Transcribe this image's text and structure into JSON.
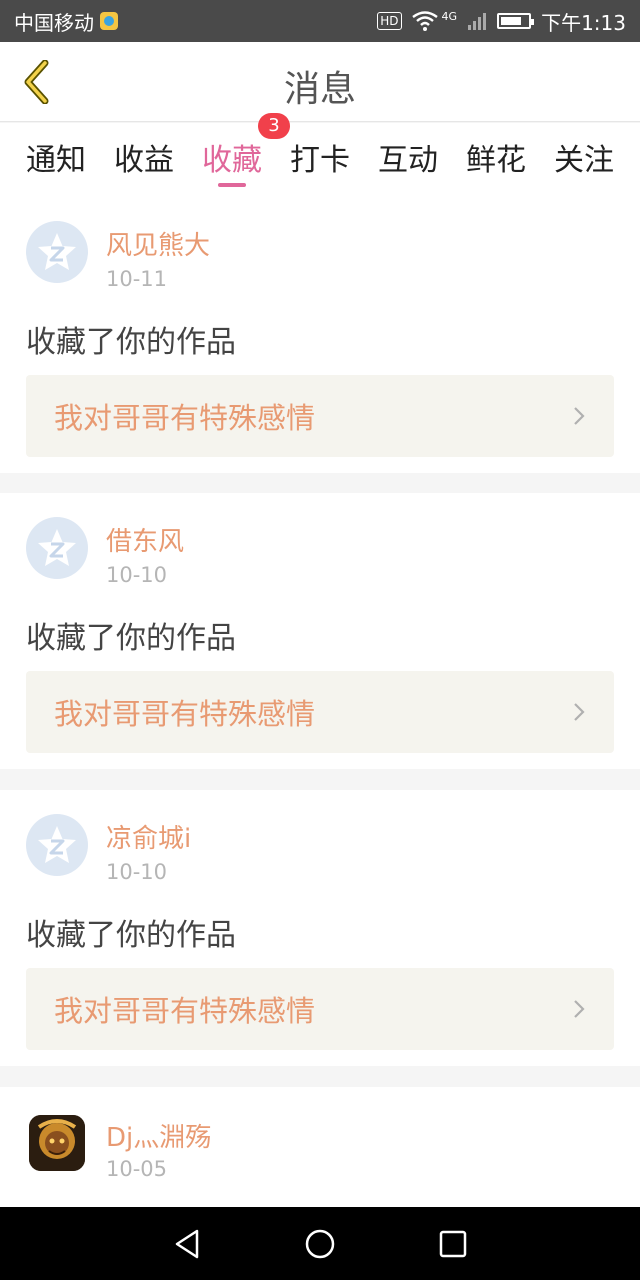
{
  "status_bar": {
    "carrier": "中国移动",
    "hd": "HD",
    "network": "4G",
    "time": "下午1:13"
  },
  "header": {
    "title": "消息",
    "back_icon": "back-chevron-icon"
  },
  "tabs": [
    {
      "label": "通知"
    },
    {
      "label": "收益"
    },
    {
      "label": "收藏",
      "active": true,
      "badge": "3"
    },
    {
      "label": "打卡"
    },
    {
      "label": "互动"
    },
    {
      "label": "鲜花"
    },
    {
      "label": "关注"
    }
  ],
  "messages": [
    {
      "user": "风见熊大",
      "date": "10-11",
      "action": "收藏了你的作品",
      "work_title": "我对哥哥有特殊感情"
    },
    {
      "user": "借东风",
      "date": "10-10",
      "action": "收藏了你的作品",
      "work_title": "我对哥哥有特殊感情"
    },
    {
      "user": "凉俞城i",
      "date": "10-10",
      "action": "收藏了你的作品",
      "work_title": "我对哥哥有特殊感情"
    },
    {
      "user": "Dj灬淵殇",
      "date": "10-05"
    }
  ],
  "colors": {
    "accent_pink": "#e0679a",
    "orange_text": "#e89a72",
    "badge_red": "#f1404b"
  }
}
